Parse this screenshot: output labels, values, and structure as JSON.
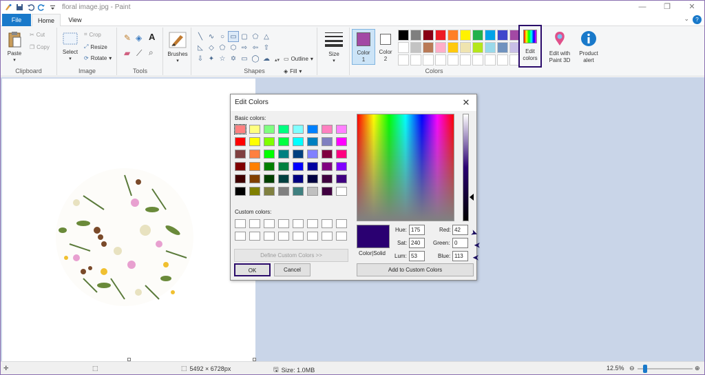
{
  "title_bar": {
    "title": "floral image.jpg - Paint",
    "minimize": "—",
    "maximize": "❐",
    "close": "✕"
  },
  "tabs": {
    "file": "File",
    "home": "Home",
    "view": "View",
    "help": "?",
    "collapse": "⌄"
  },
  "ribbon": {
    "clipboard": {
      "paste": "Paste",
      "cut": "Cut",
      "copy": "Copy",
      "label": "Clipboard"
    },
    "image": {
      "select": "Select",
      "crop": "Crop",
      "resize": "Resize",
      "rotate": "Rotate",
      "label": "Image"
    },
    "tools": {
      "label": "Tools"
    },
    "brushes": {
      "label": "Brushes"
    },
    "shapes": {
      "outline": "Outline",
      "fill": "Fill",
      "label": "Shapes"
    },
    "size": {
      "label": "Size"
    },
    "color1": {
      "label_a": "Color",
      "label_b": "1"
    },
    "color2": {
      "label_a": "Color",
      "label_b": "2"
    },
    "colors": {
      "label": "Colors"
    },
    "edit_colors": {
      "label_a": "Edit",
      "label_b": "colors"
    },
    "paint3d": {
      "label_a": "Edit with",
      "label_b": "Paint 3D"
    },
    "product_alert": {
      "label_a": "Product",
      "label_b": "alert"
    }
  },
  "palette": [
    "#000000",
    "#7f7f7f",
    "#880015",
    "#ed1c24",
    "#ff7f27",
    "#fff200",
    "#22b14c",
    "#00a2e8",
    "#3f48cc",
    "#a349a4",
    "#ffffff",
    "#c3c3c3",
    "#b97a57",
    "#ffaec9",
    "#ffc90e",
    "#efe4b0",
    "#b5e61d",
    "#99d9ea",
    "#7092be",
    "#c8bfe7",
    "#ffffff",
    "#ffffff",
    "#ffffff",
    "#ffffff",
    "#ffffff",
    "#ffffff",
    "#ffffff",
    "#ffffff",
    "#ffffff",
    "#ffffff"
  ],
  "color1_value": "#a349a4",
  "dialog": {
    "title": "Edit Colors",
    "close": "✕",
    "basic_label": "Basic colors:",
    "custom_label": "Custom colors:",
    "basic_colors": [
      "#ff8080",
      "#ffff80",
      "#80ff80",
      "#00ff80",
      "#80ffff",
      "#0080ff",
      "#ff80c0",
      "#ff80ff",
      "#ff0000",
      "#ffff00",
      "#80ff00",
      "#00ff40",
      "#00ffff",
      "#0080c0",
      "#8080c0",
      "#ff00ff",
      "#804040",
      "#ff8040",
      "#00ff00",
      "#008080",
      "#004080",
      "#8080ff",
      "#800040",
      "#ff0080",
      "#800000",
      "#ff8000",
      "#008000",
      "#008040",
      "#0000ff",
      "#0000a0",
      "#800080",
      "#8000ff",
      "#400000",
      "#804000",
      "#004000",
      "#004040",
      "#000080",
      "#000040",
      "#400040",
      "#400080",
      "#000000",
      "#808000",
      "#808040",
      "#808080",
      "#408080",
      "#c0c0c0",
      "#400040",
      "#ffffff"
    ],
    "define_button": "Define Custom Colors >>",
    "ok": "OK",
    "cancel": "Cancel",
    "color_solid": "Color|Solid",
    "add_button": "Add to Custom Colors",
    "hue_label": "Hue:",
    "hue": "175",
    "sat_label": "Sat:",
    "sat": "240",
    "lum_label": "Lum:",
    "lum": "53",
    "red_label": "Red:",
    "red": "42",
    "green_label": "Green:",
    "green": "0",
    "blue_label": "Blue:",
    "blue": "113",
    "current_color": "#2a0071"
  },
  "status": {
    "dimensions": "5492 × 6728px",
    "size": "Size: 1.0MB",
    "zoom": "12.5%"
  }
}
